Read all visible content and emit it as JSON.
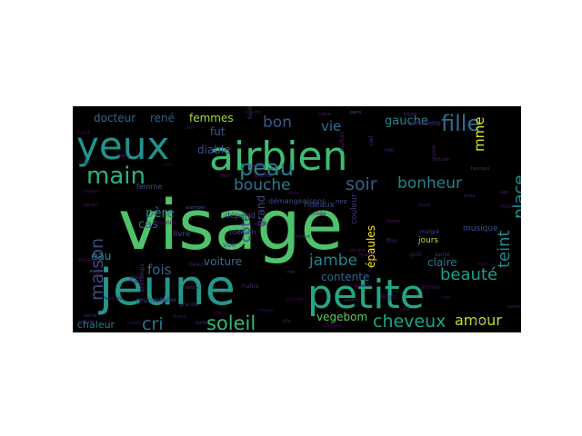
{
  "figure": {
    "background": "#000000",
    "page_background": "#ffffff"
  },
  "words": [
    {
      "text": "visage",
      "color": "#4fc36b"
    },
    {
      "text": "jeune",
      "color": "#26968a"
    },
    {
      "text": "yeux",
      "color": "#24908c"
    },
    {
      "text": "airbien",
      "color": "#3fbc73"
    },
    {
      "text": "petite",
      "color": "#22a785"
    },
    {
      "text": "main",
      "color": "#2db27d"
    },
    {
      "text": "peau",
      "color": "#287c8e"
    },
    {
      "text": "fille",
      "color": "#2f6c8e"
    },
    {
      "text": "soleil",
      "color": "#35b779"
    },
    {
      "text": "cheveux",
      "color": "#20a386"
    },
    {
      "text": "bouche",
      "color": "#2a788e"
    },
    {
      "text": "bonheur",
      "color": "#277f8e"
    },
    {
      "text": "soir",
      "color": "#34608d"
    },
    {
      "text": "beauté",
      "color": "#1f9e89"
    },
    {
      "text": "teint",
      "color": "#238a8d"
    },
    {
      "text": "place",
      "color": "#21918c"
    },
    {
      "text": "mme",
      "color": "#dde318"
    },
    {
      "text": "maison",
      "color": "#3e4a89"
    },
    {
      "text": "jambe",
      "color": "#26828e"
    },
    {
      "text": "amour",
      "color": "#bddf26"
    },
    {
      "text": "cri",
      "color": "#2c728e"
    },
    {
      "text": "fois",
      "color": "#31678e"
    },
    {
      "text": "bon",
      "color": "#38598c"
    },
    {
      "text": "vie",
      "color": "#2d708e"
    },
    {
      "text": "gauche",
      "color": "#25858e"
    },
    {
      "text": "femmes",
      "color": "#a0da39"
    },
    {
      "text": "docteur",
      "color": "#30698e"
    },
    {
      "text": "rené",
      "color": "#355f8d"
    },
    {
      "text": "fut",
      "color": "#39568c"
    },
    {
      "text": "diable",
      "color": "#3b528b"
    },
    {
      "text": "père",
      "color": "#2a788e"
    },
    {
      "text": "cas",
      "color": "#33638d"
    },
    {
      "text": "eau",
      "color": "#21918c"
    },
    {
      "text": "côté",
      "color": "#3b518b"
    },
    {
      "text": "grand",
      "color": "#414487"
    },
    {
      "text": "épaules",
      "color": "#fde725"
    },
    {
      "text": "voiture",
      "color": "#2e6e8e"
    },
    {
      "text": "vegebom",
      "color": "#5ec962"
    },
    {
      "text": "claire",
      "color": "#2c738e"
    },
    {
      "text": "contente",
      "color": "#31678e"
    },
    {
      "text": "chaleur",
      "color": "#2b758e"
    },
    {
      "text": "application",
      "color": "#3e4989"
    },
    {
      "text": "couleur",
      "color": "#453781"
    },
    {
      "text": "musique",
      "color": "#3b528b"
    },
    {
      "text": "jours",
      "color": "#b5de2b"
    },
    {
      "text": "rideaux",
      "color": "#3f4788"
    },
    {
      "text": "livre",
      "color": "#424086"
    },
    {
      "text": "démangeaisons",
      "color": "#3e4989"
    },
    {
      "text": "dépend",
      "color": "#404387"
    },
    {
      "text": "tokalon",
      "color": "#3f4788"
    },
    {
      "text": "voir",
      "color": "#414487"
    },
    {
      "text": "jeunesse",
      "color": "#3f4889"
    },
    {
      "text": "femme",
      "color": "#3c4f8a"
    },
    {
      "text": "nez",
      "color": "#3a548c"
    },
    {
      "text": "silhouette",
      "color": "#46337e"
    },
    {
      "text": "noire",
      "color": "#481f70"
    },
    {
      "text": "santé",
      "color": "#472c7a"
    },
    {
      "text": "belles",
      "color": "#3e4a89"
    },
    {
      "text": "printemps",
      "color": "#46307e"
    },
    {
      "text": "parfum",
      "color": "#481b6d"
    },
    {
      "text": "fortune",
      "color": "#482475"
    },
    {
      "text": "heureux",
      "color": "#46307e"
    },
    {
      "text": "paris",
      "color": "#3b528b"
    },
    {
      "text": "louise",
      "color": "#482878"
    },
    {
      "text": "malgré",
      "color": "#443a83"
    },
    {
      "text": "frère",
      "color": "#472e7c"
    },
    {
      "text": "fenêtre",
      "color": "#46327e"
    },
    {
      "text": "famille",
      "color": "#433e85"
    },
    {
      "text": "exemple",
      "color": "#39568c"
    },
    {
      "text": "douce",
      "color": "#463480"
    },
    {
      "text": "boire",
      "color": "#482979"
    },
    {
      "text": "formes",
      "color": "#471365"
    },
    {
      "text": "crème",
      "color": "#482677"
    },
    {
      "text": "année",
      "color": "#481769"
    },
    {
      "text": "ciel",
      "color": "#443983"
    },
    {
      "text": "goût",
      "color": "#48186a"
    },
    {
      "text": "réel",
      "color": "#48186a"
    },
    {
      "text": "fine",
      "color": "#482475"
    },
    {
      "text": "doigts",
      "color": "#471063"
    },
    {
      "text": "calcaire",
      "color": "#46075a"
    },
    {
      "text": "fabienne",
      "color": "#450559"
    },
    {
      "text": "rose",
      "color": "#481467"
    },
    {
      "text": "eugénie",
      "color": "#440154"
    },
    {
      "text": "maître",
      "color": "#482173"
    },
    {
      "text": "grande",
      "color": "#472a7a"
    },
    {
      "text": "matin",
      "color": "#471365"
    },
    {
      "text": "beaux",
      "color": "#481a6c"
    },
    {
      "text": "gros",
      "color": "#482979"
    },
    {
      "text": "donner",
      "color": "#45085b"
    },
    {
      "text": "année",
      "color": "#481f70"
    },
    {
      "text": "disparut",
      "color": "#460b5e"
    },
    {
      "text": "argent",
      "color": "#46085c"
    },
    {
      "text": "mois",
      "color": "#481467"
    },
    {
      "text": "idéal",
      "color": "#460a5d"
    },
    {
      "text": "front",
      "color": "#470e61"
    },
    {
      "text": "arrière",
      "color": "#481769"
    },
    {
      "text": "mari",
      "color": "#46075a"
    },
    {
      "text": "mère",
      "color": "#450457"
    },
    {
      "text": "ville",
      "color": "#481a6c"
    },
    {
      "text": "enfant",
      "color": "#482071"
    },
    {
      "text": "heures",
      "color": "#470d60"
    },
    {
      "text": "temps",
      "color": "#471063"
    },
    {
      "text": "seule",
      "color": "#46085c"
    },
    {
      "text": "blanc",
      "color": "#481668"
    },
    {
      "text": "coeur",
      "color": "#482374"
    },
    {
      "text": "nuit",
      "color": "#440154"
    },
    {
      "text": "amie",
      "color": "#481b6d"
    },
    {
      "text": "mots",
      "color": "#46075a"
    },
    {
      "text": "mains",
      "color": "#470e61"
    },
    {
      "text": "lèvres",
      "color": "#48186a"
    },
    {
      "text": "robe",
      "color": "#481467"
    },
    {
      "text": "journée",
      "color": "#46085c"
    },
    {
      "text": "teinte",
      "color": "#472a7a"
    },
    {
      "text": "joie",
      "color": "#460a5d"
    },
    {
      "text": "parole",
      "color": "#481c6e"
    },
    {
      "text": "vague",
      "color": "#450559"
    },
    {
      "text": "brune",
      "color": "#471164"
    },
    {
      "text": "savon",
      "color": "#482475"
    },
    {
      "text": "poudre",
      "color": "#46085c"
    },
    {
      "text": "âge",
      "color": "#481769"
    },
    {
      "text": "ans",
      "color": "#470e61"
    },
    {
      "text": "fleur",
      "color": "#481a6c"
    },
    {
      "text": "soins",
      "color": "#450559"
    },
    {
      "text": "rire",
      "color": "#472e7c"
    }
  ]
}
